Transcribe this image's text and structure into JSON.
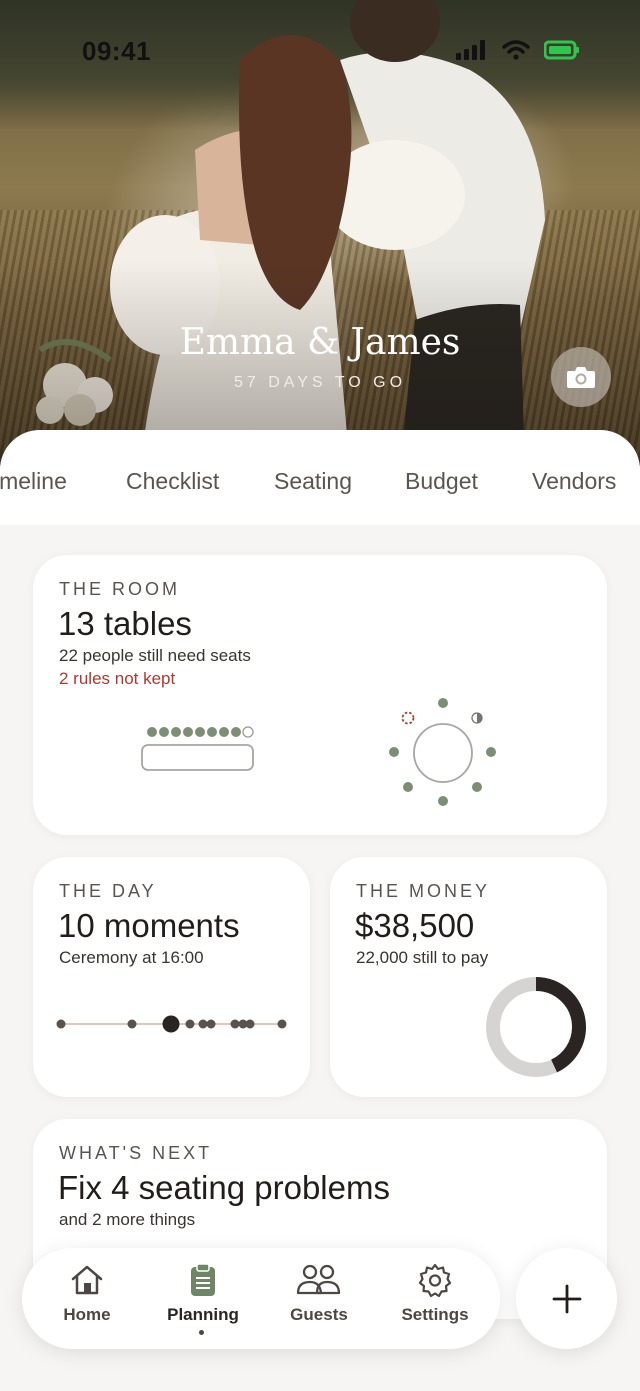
{
  "status": {
    "time": "09:41"
  },
  "hero": {
    "title": "Emma & James",
    "countdown": "57 DAYS TO GO",
    "camera_icon": "camera-icon"
  },
  "tabs": [
    "Timeline",
    "Checklist",
    "Seating",
    "Budget",
    "Vendors"
  ],
  "tabs_visible": [
    "imeline",
    "Checklist",
    "Seating",
    "Budget",
    "Vendors"
  ],
  "room": {
    "label": "THE ROOM",
    "value": "13 tables",
    "sub": "22 people still need seats",
    "warning": "2 rules not kept"
  },
  "day": {
    "label": "THE DAY",
    "value": "10 moments",
    "sub": "Ceremony at 16:00"
  },
  "money": {
    "label": "THE MONEY",
    "value": "$38,500",
    "sub": "22,000 still to pay",
    "paid_fraction": 0.43
  },
  "next": {
    "label": "WHAT'S NEXT",
    "value": "Fix 4 seating problems",
    "sub": "and 2 more things"
  },
  "nav": {
    "home": "Home",
    "planning": "Planning",
    "guests": "Guests",
    "settings": "Settings"
  },
  "colors": {
    "accent": "#7c8f74",
    "warning": "#b0382e",
    "dark": "#2a2522"
  }
}
